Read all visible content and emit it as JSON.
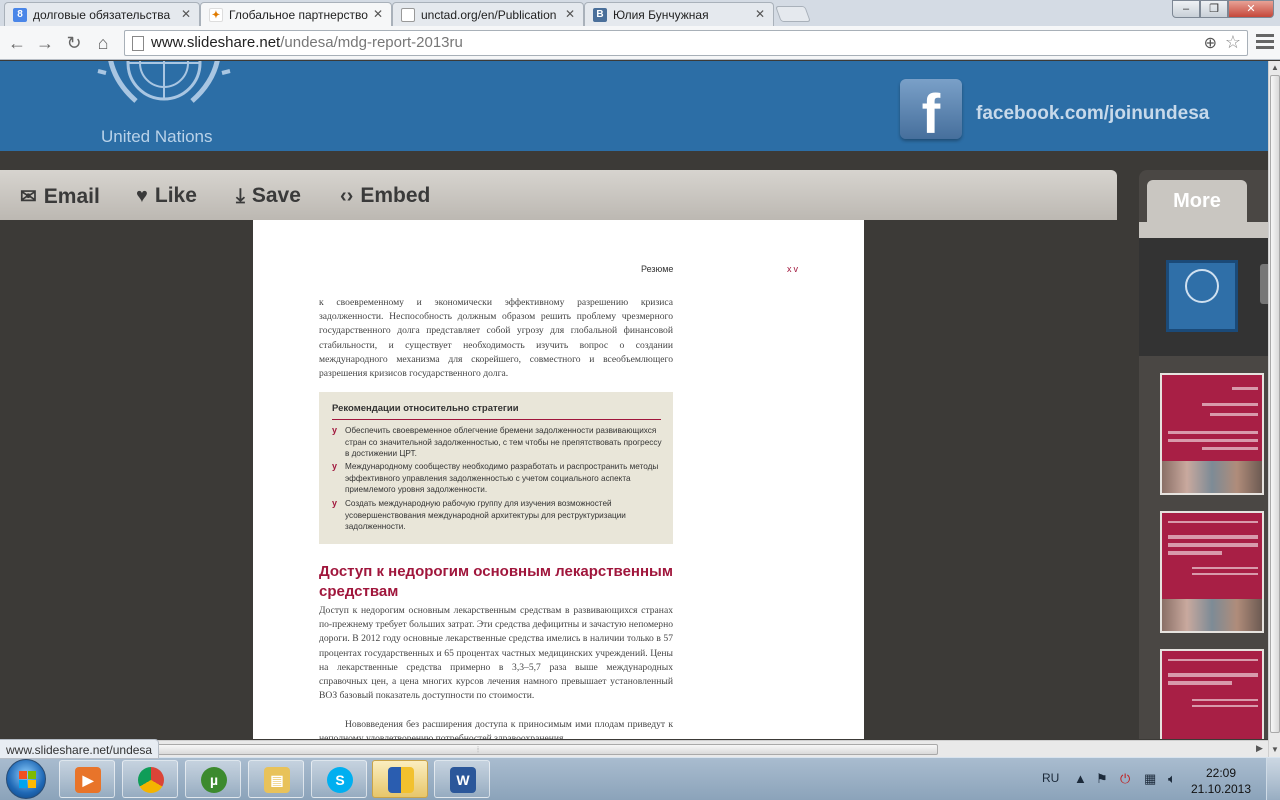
{
  "browser": {
    "tabs": [
      {
        "title": "долговые обязательства",
        "favicon": "google-icon",
        "active": false
      },
      {
        "title": "Глобальное партнерство",
        "favicon": "slideshare-icon",
        "active": true
      },
      {
        "title": "unctad.org/en/Publication",
        "favicon": "page-icon",
        "active": false
      },
      {
        "title": "Юлия Бунчужная",
        "favicon": "vk-icon",
        "active": false
      }
    ],
    "url": {
      "host": "www.slideshare.net",
      "path": "/undesa/mdg-report-2013ru"
    },
    "status_url": "www.slideshare.net/undesa"
  },
  "banner": {
    "org_name": "United Nations",
    "facebook_link": "facebook.com/joinundesa"
  },
  "actions": {
    "email": "Email",
    "like": "Like",
    "save": "Save",
    "embed": "Embed"
  },
  "sidebar": {
    "more_tab": "More"
  },
  "document": {
    "running_head": "Резюме",
    "page_number": "xv",
    "intro_paragraph": "к своевременному и экономически эффективному разрешению кризиса задолженности. Неспособность должным образом решить проблему чрезмерного государственного долга представляет собой угрозу для глобальной финансовой стабильности, и существует необходимость изучить вопрос о создании международного механизма для скорейшего, совместного и всеобъемлющего разрешения кризисов государственного долга.",
    "recommendations": {
      "title": "Рекомендации относительно стратегии",
      "items": [
        "Обеспечить своевременное облегчение бремени задолженности развивающихся стран со значительной задолженностью, с тем чтобы не препятствовать прогрессу в достижении ЦРТ.",
        "Международному сообществу необходимо разработать и распространить методы эффективного управления задолженностью с учетом социального аспекта приемлемого уровня задолженности.",
        "Создать международную рабочую группу для изучения возможностей усовершенствования международной архитектуры для реструктуризации задолженности."
      ]
    },
    "section_heading": "Доступ к недорогим основным лекарственным средствам",
    "section_paragraph": "Доступ к недорогим основным лекарственным средствам в развивающихся странах по-прежнему требует больших затрат. Эти средства дефицитны и зачастую непомерно дороги. В 2012 году основные лекарственные средства имелись в наличии только в 57 процентах государственных и 65 процентах частных медицинских учреждений. Цены на лекарственные средства примерно в 3,3–5,7 раза выше международных справочных цен, а цена многих курсов лечения намного превышает установленный ВОЗ базовый показатель доступности по стоимости.",
    "next_paragraph": "Нововведения без расширения доступа к приносимым ими плодам приведут к неполному удовлетворению потребностей здравоохранения."
  },
  "taskbar": {
    "language": "RU",
    "time": "22:09",
    "date": "21.10.2013",
    "apps": [
      "media-player-icon",
      "chrome-icon",
      "utorrent-icon",
      "explorer-icon",
      "skype-icon",
      "security-shield-icon",
      "word-icon"
    ]
  }
}
